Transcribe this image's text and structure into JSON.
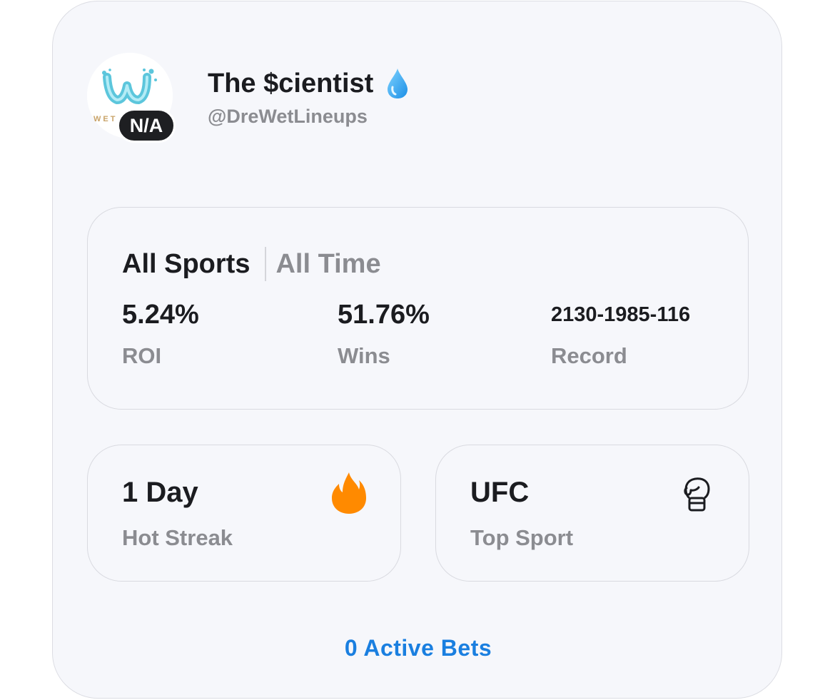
{
  "profile": {
    "badge": "N/A",
    "name": "The $cientist",
    "handle": "@DreWetLineups",
    "avatar_logo_text": "WET"
  },
  "stats": {
    "sport_filter": "All Sports",
    "time_filter": "All Time",
    "roi_value": "5.24%",
    "roi_label": "ROI",
    "wins_value": "51.76%",
    "wins_label": "Wins",
    "record_value": "2130-1985-116",
    "record_label": "Record"
  },
  "streak": {
    "value": "1 Day",
    "label": "Hot Streak",
    "icon": "fire-icon"
  },
  "top_sport": {
    "value": "UFC",
    "label": "Top Sport",
    "icon": "boxing-glove-icon"
  },
  "active_bets": "0 Active Bets",
  "colors": {
    "accent": "#1a7fe0",
    "fire": "#ff8a00",
    "badge_bg": "#1e1f22",
    "card_bg": "#f6f7fb"
  }
}
